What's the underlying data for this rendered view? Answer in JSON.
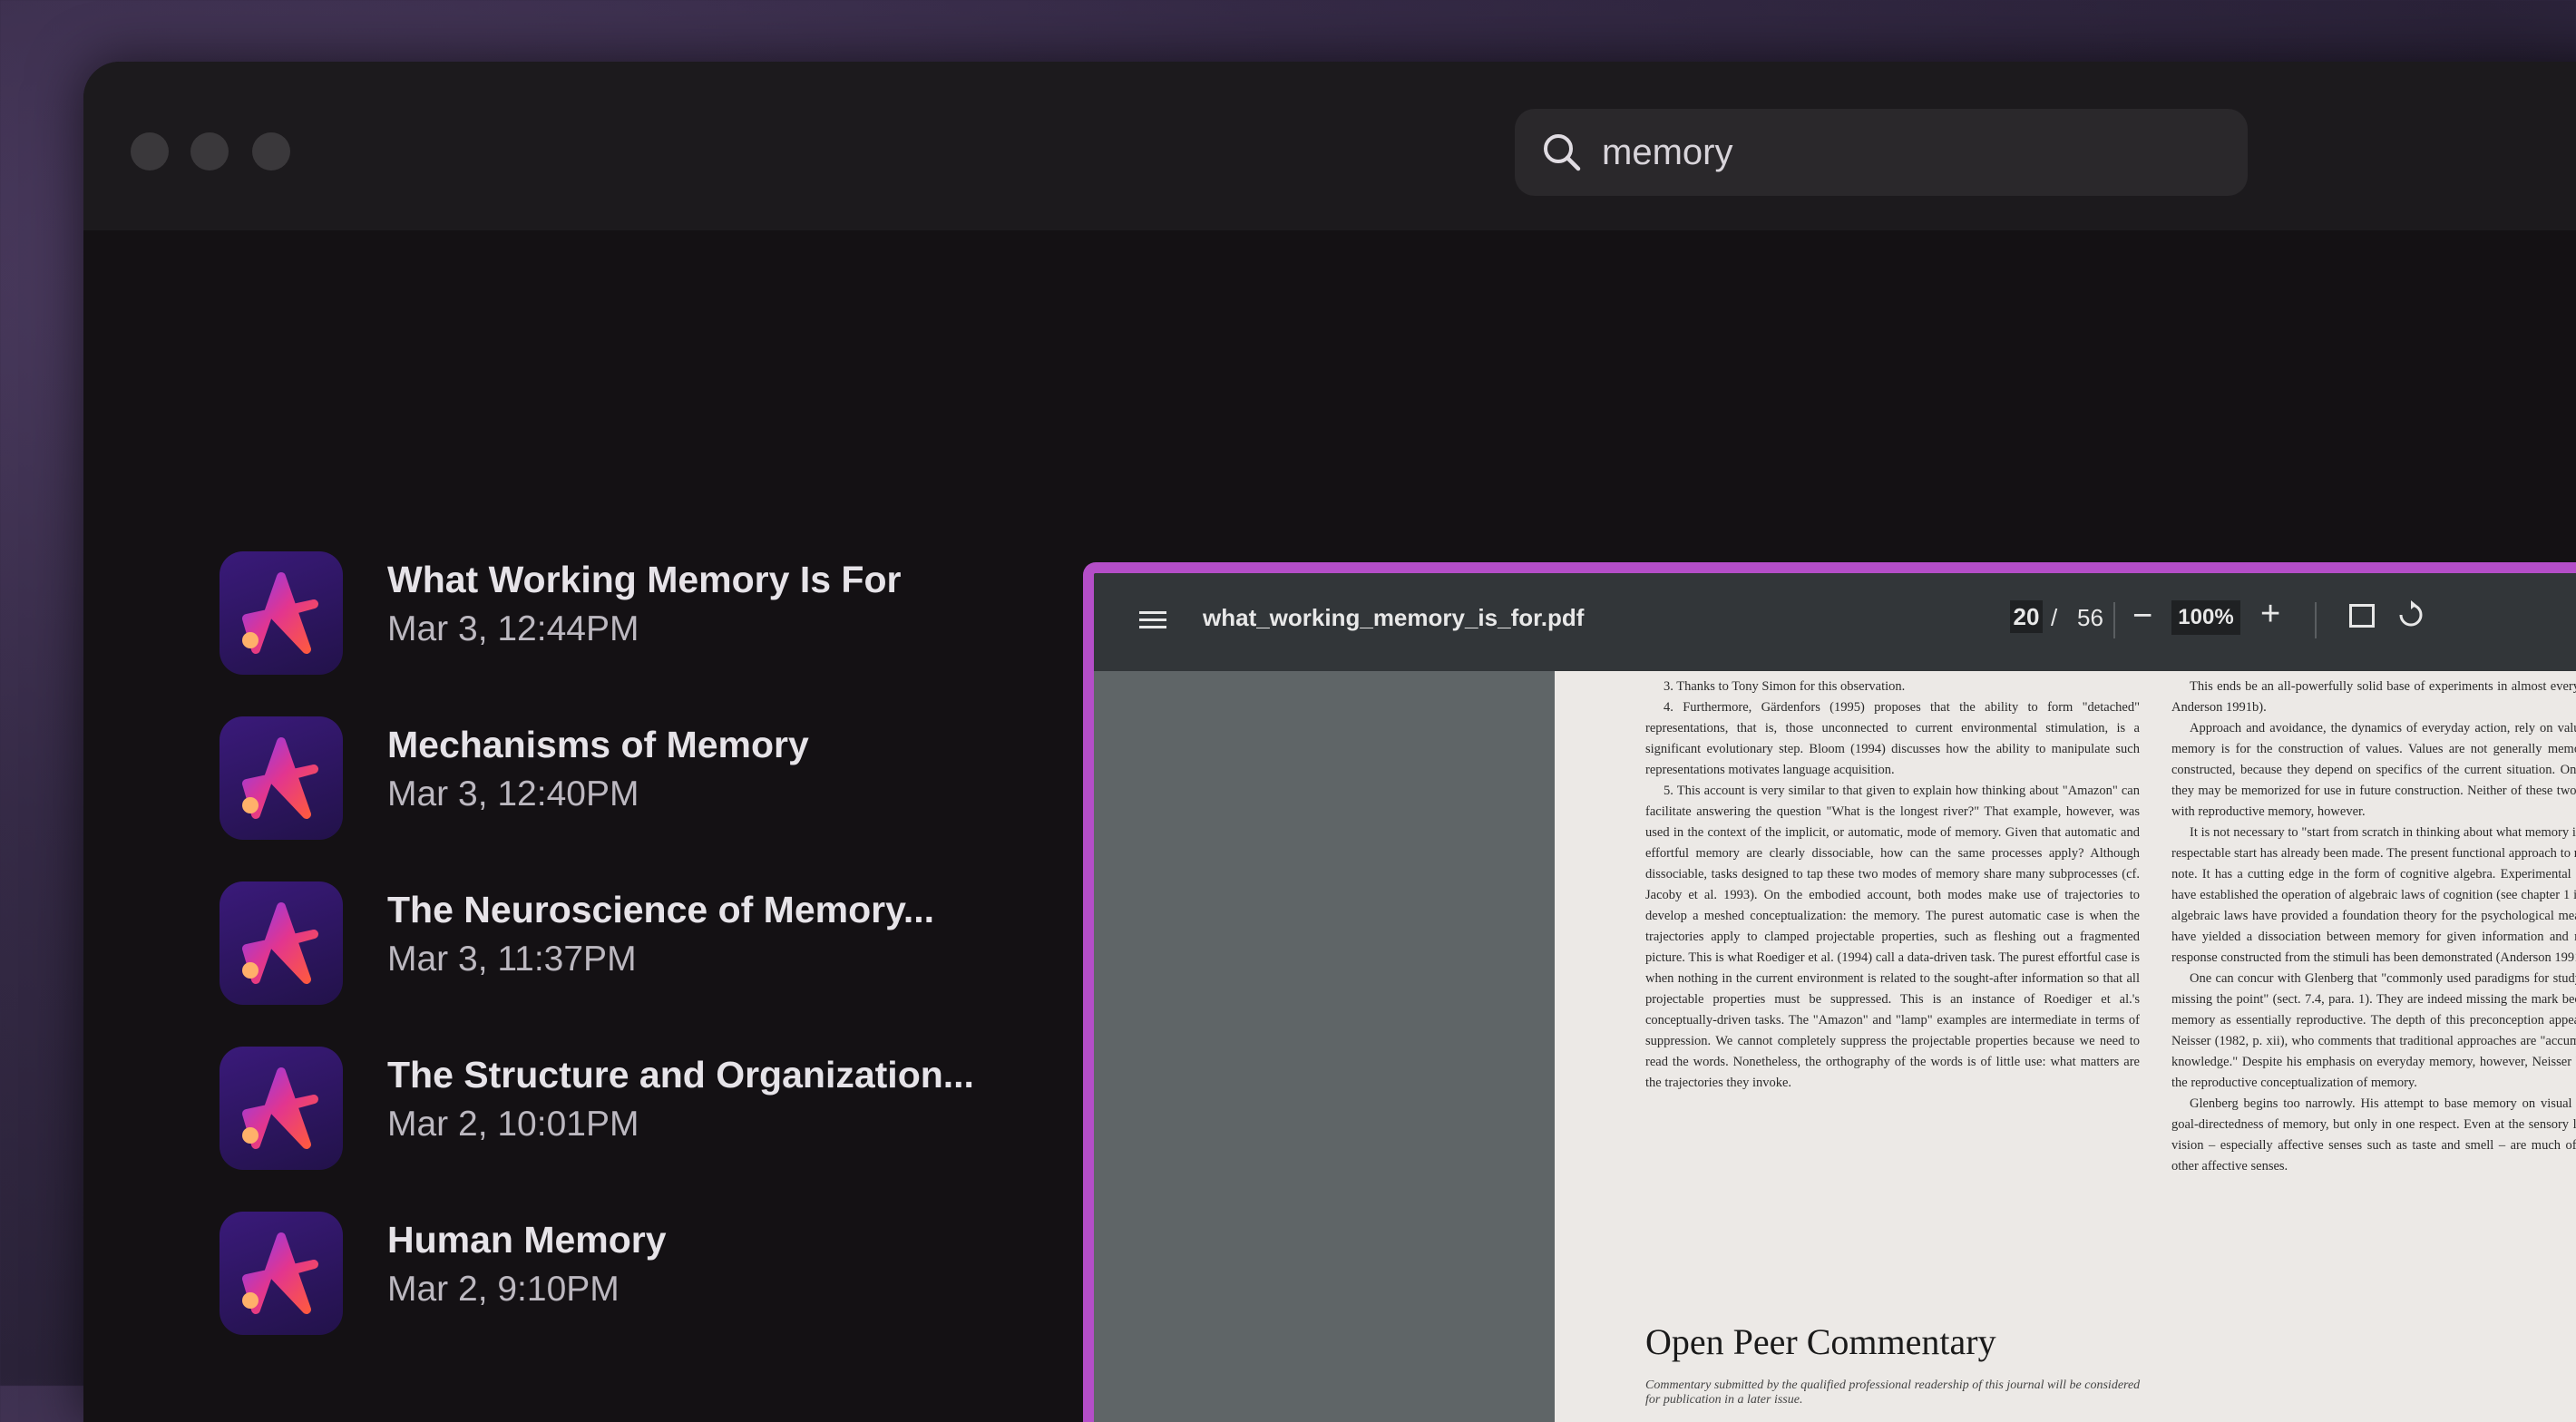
{
  "search": {
    "query": "memory"
  },
  "results": [
    {
      "title": "What Working Memory Is For",
      "date": "Mar 3, 12:44PM"
    },
    {
      "title": "Mechanisms of Memory",
      "date": "Mar 3, 12:40PM"
    },
    {
      "title": "The Neuroscience of Memory...",
      "date": "Mar 3, 11:37PM"
    },
    {
      "title": "The Structure and Organization...",
      "date": "Mar 2, 10:01PM"
    },
    {
      "title": "Human Memory",
      "date": "Mar 2, 9:10PM"
    }
  ],
  "viewer": {
    "filename": "what_working_memory_is_for.pdf",
    "page": "20",
    "separator": "/",
    "total_pages": "56",
    "zoom": "100%",
    "zoom_out": "−",
    "zoom_in": "+",
    "accent": "#b44ec8"
  },
  "document": {
    "col1": [
      "3. Thanks to Tony Simon for this observation.",
      "4. Furthermore, Gärdenfors (1995) proposes that the ability to form \"detached\" representations, that is, those unconnected to current environmental stimulation, is a significant evolutionary step. Bloom (1994) discusses how the ability to manipulate such representations motivates language acquisition.",
      "5. This account is very similar to that given to explain how thinking about \"Amazon\" can facilitate answering the question \"What is the longest river?\" That example, however, was used in the context of the implicit, or automatic, mode of memory. Given that automatic and effortful memory are clearly dissociable, how can the same processes apply? Although dissociable, tasks designed to tap these two modes of memory share many subprocesses (cf. Jacoby et al. 1993). On the embodied account, both modes make use of trajectories to develop a meshed conceptualization: the memory. The purest automatic case is when the trajectories apply to clamped projectable properties, such as fleshing out a fragmented picture. This is what Roediger et al. (1994) call a data-driven task. The purest effortful case is when nothing in the current environment is related to the sought-after information so that all projectable properties must be suppressed. This is an instance of Roediger et al.'s conceptually-driven tasks. The \"Amazon\" and \"lamp\" examples are intermediate in terms of suppression. We cannot completely suppress the projectable properties because we need to read the words. Nonetheless, the orthography of the words is of little use: what matters are the trajectories they invoke."
    ],
    "col2": [
      "This ends be an all-powerfully solid base of experiments in almost every area of psychology (e.g., Anderson 1991b).",
      "Approach and avoidance, the dynamics of everyday action, rely on values. One main function of memory is for the construction of values. Values are not generally memorized or represented, but constructed, because they depend on specifics of the current situation. Once constructed, of course, they may be memorized for use in future construction. Neither of these two functions has much to do with reproductive memory, however.",
      "It is not necessary to \"start from scratch in thinking about what memory is for\" (abstract), because a respectable start has already been made. The present functional approach to memory is in a promissory note. It has a cutting edge in the form of cognitive algebra. Experimental studies in numerous areas have established the operation of algebraic laws of cognition (see chapter 1 in Anderson 1991a). These algebraic laws have provided a foundation theory for the psychological measurement of values. They have yielded a dissociation between memory for given information and memory for an integrated response constructed from the stimuli has been demonstrated (Anderson 1991b, pp. 11-14).",
      "One can concur with Glenberg that \"commonly used paradigms for studying memory may well be missing the point\" (sect. 7.4, para. 1). They are indeed missing the mark because they have prejudged memory as essentially reproductive. The depth of this preconception appears even in critics such as Neisser (1982, p. xii), who comments that traditional approaches are \"accumulating the wrong kind of knowledge.\" Despite his emphasis on everyday memory, however, Neisser himself remains bound by the reproductive conceptualization of memory.",
      "Glenberg begins too narrowly. His attempt to base memory on visual perception recognizes the goal-directedness of memory, but only in one respect. Even at the sensory level, many senses besides vision – especially affective senses such as taste and smell – are much of everyday life. These and other affective senses."
    ],
    "heading": "Open Peer Commentary",
    "footnote": "Commentary submitted by the qualified professional readership of this journal will be considered for publication in a later issue."
  }
}
